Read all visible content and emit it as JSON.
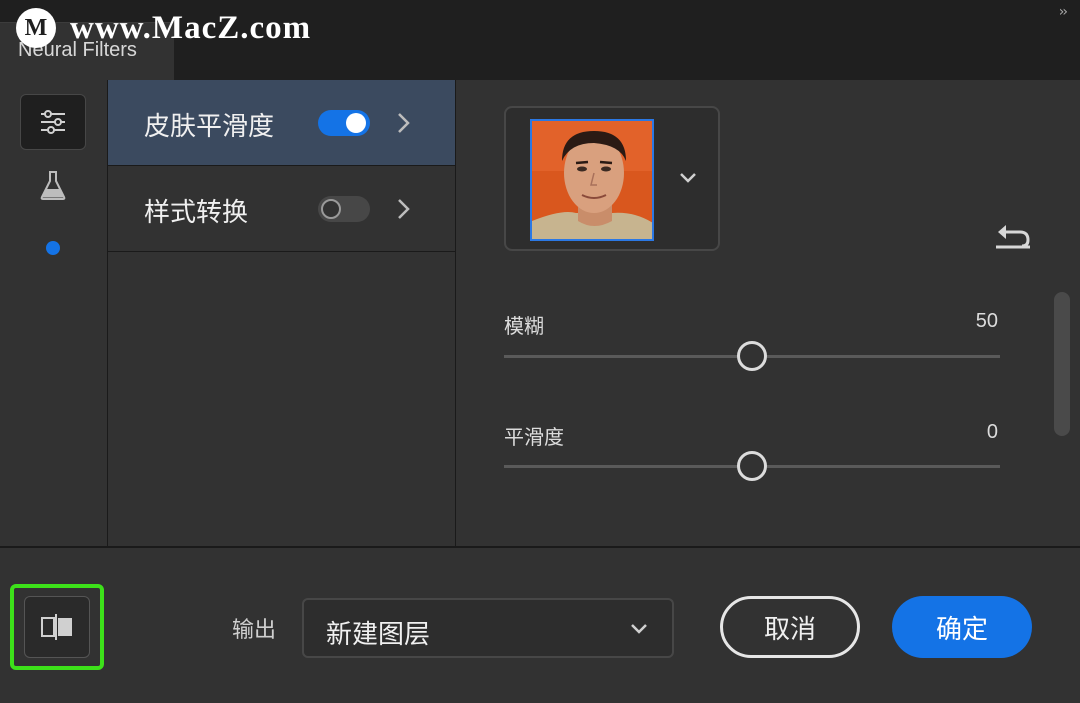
{
  "watermark": {
    "logo_letter": "M",
    "text": "www.MacZ.com"
  },
  "panel": {
    "title": "Neural Filters",
    "collapse_icon": "double-chevron-right-icon"
  },
  "rail": {
    "items": [
      {
        "icon": "sliders-icon",
        "selected": true
      },
      {
        "icon": "flask-icon",
        "selected": false
      },
      {
        "icon": "dot-indicator-icon",
        "selected": false
      }
    ]
  },
  "filters": [
    {
      "label": "皮肤平滑度",
      "enabled": true,
      "selected": true
    },
    {
      "label": "样式转换",
      "enabled": false,
      "selected": false
    }
  ],
  "settings": {
    "face_thumbnail_icon": "portrait-thumbnail",
    "reset_icon": "undo-icon",
    "sliders": [
      {
        "label": "模糊",
        "value": "50",
        "level": 0.5
      },
      {
        "label": "平滑度",
        "value": "0",
        "level": 0.5
      }
    ]
  },
  "footer": {
    "compare_icon": "split-compare-icon",
    "output_label": "输出",
    "output_value": "新建图层",
    "cancel_label": "取消",
    "ok_label": "确定"
  },
  "colors": {
    "accent": "#1473e6",
    "highlight": "#3de11a",
    "selected_row": "#3b4a5f"
  }
}
